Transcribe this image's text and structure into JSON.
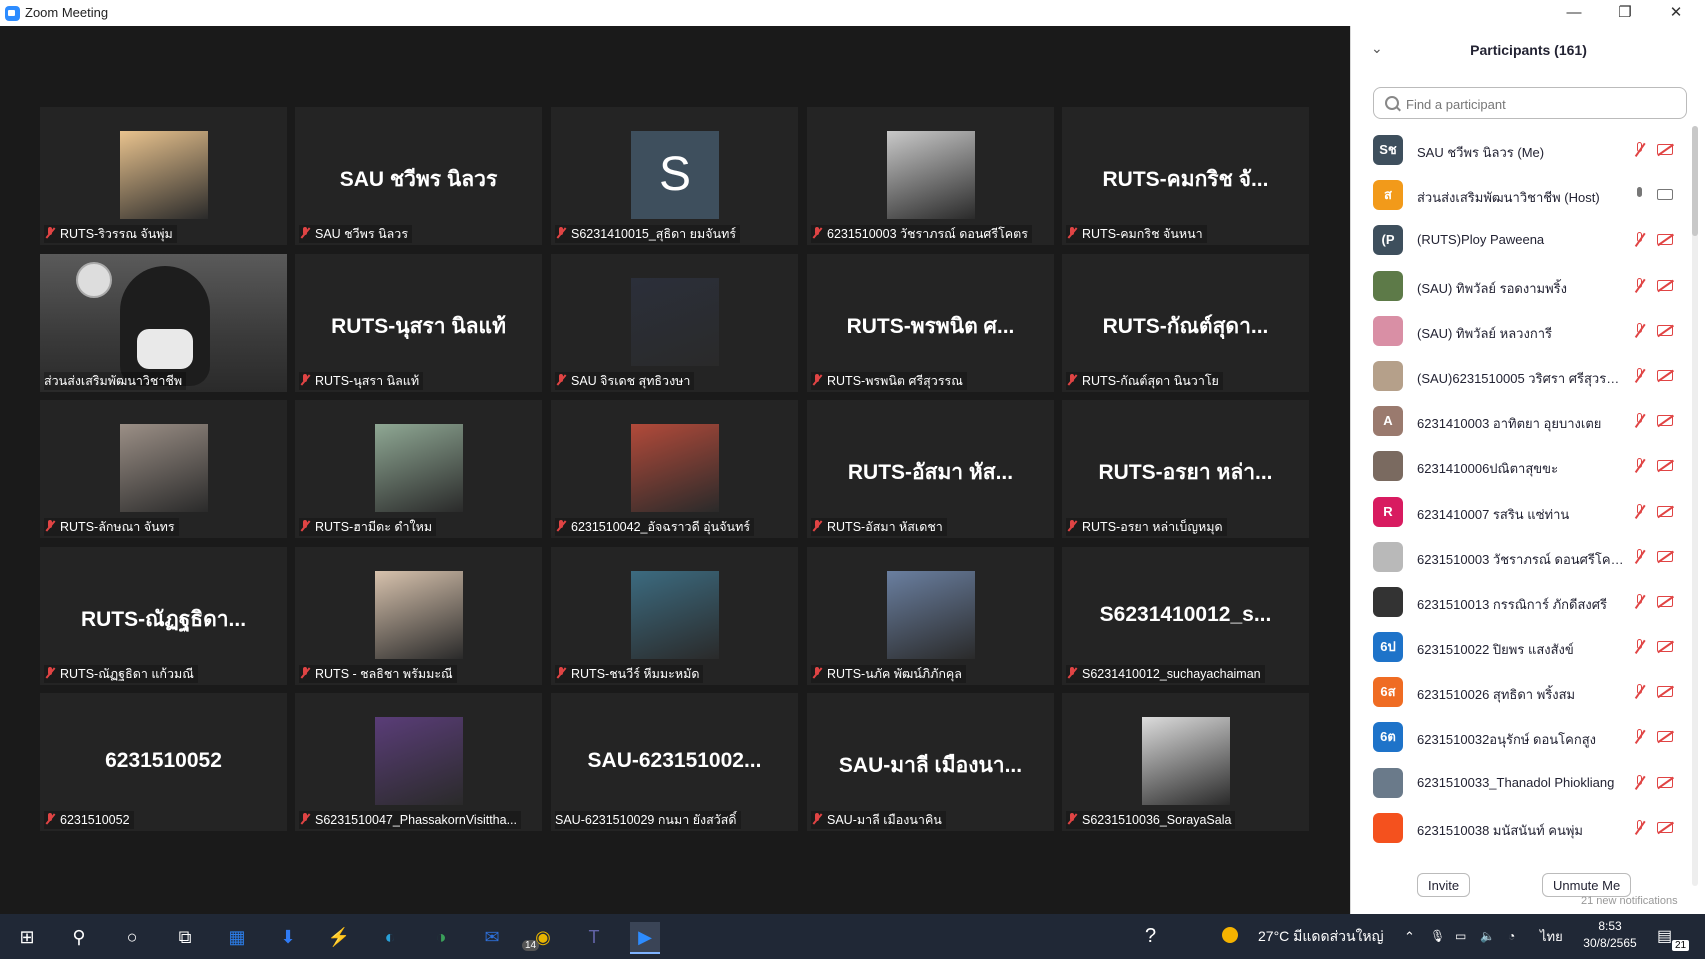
{
  "window": {
    "title": "Zoom Meeting",
    "minimize": "—",
    "restore": "❐",
    "close": "✕"
  },
  "tiles": [
    {
      "label": "RUTS-ริวรรณ จันพุ่ม",
      "big": "",
      "thumb": "photo",
      "color": "#e9c38e"
    },
    {
      "label": "SAU ชวีพร นิลวร",
      "big": "SAU ชวีพร นิลวร"
    },
    {
      "label": "S6231410015_สุธิดา ยมจันทร์",
      "big": "",
      "thumb": "letter",
      "letter": "S"
    },
    {
      "label": "6231510003 วัชราภรณ์ ดอนศรีโคตร",
      "big": "",
      "thumb": "photo",
      "color": "#c9c9c9"
    },
    {
      "label": "RUTS-คมกริช จันหนา",
      "big": "RUTS-คมกริช  จั..."
    },
    {
      "label": "ส่วนส่งเสริมพัฒนาวิชาชีพ",
      "big": "",
      "thumb": "full"
    },
    {
      "label": "RUTS-นุสรา นิลแท้",
      "big": "RUTS-นุสรา นิลแท้"
    },
    {
      "label": "SAU จิรเดช สุทธิวงษา",
      "big": "",
      "thumb": "photo",
      "color": "#2b2f3a"
    },
    {
      "label": "RUTS-พรพนิต ศรีสุวรรณ",
      "big": "RUTS-พรพนิต ศ..."
    },
    {
      "label": "RUTS-กัณต์สุดา นินวาโย",
      "big": "RUTS-กัณต์สุดา..."
    },
    {
      "label": "RUTS-ลักษณา จันทร",
      "big": "",
      "thumb": "photo",
      "color": "#9b8f86"
    },
    {
      "label": "RUTS-ฮามีดะ ดำใหม",
      "big": "",
      "thumb": "photo",
      "color": "#8fa894"
    },
    {
      "label": "6231510042_อัจฉราวดี อุ่นจันทร์",
      "big": "",
      "thumb": "photo",
      "color": "#b24a3a"
    },
    {
      "label": "RUTS-อัสมา หัสเดชา",
      "big": "RUTS-อัสมา หัส..."
    },
    {
      "label": "RUTS-อรยา หล่าเบ็ญหมุด",
      "big": "RUTS-อรยา  หล่า..."
    },
    {
      "label": "RUTS-ณัฏฐธิดา แก้วมณี",
      "big": "RUTS-ณัฏฐธิดา..."
    },
    {
      "label": "RUTS - ชลธิชา พรัมมะณี",
      "big": "",
      "thumb": "photo",
      "color": "#d7c2ad"
    },
    {
      "label": "RUTS-ชนวีร์ หีมมะหมัด",
      "big": "",
      "thumb": "photo",
      "color": "#3c6b80"
    },
    {
      "label": "RUTS-นภัค พัฒน์ภิภักคุล",
      "big": "",
      "thumb": "photo",
      "color": "#6a7fa0"
    },
    {
      "label": "S6231410012_suchayachaiman",
      "big": "S6231410012_s..."
    },
    {
      "label": "6231510052",
      "big": "6231510052"
    },
    {
      "label": "S6231510047_PhassakornVisittha...",
      "big": "",
      "thumb": "photo",
      "color": "#5a3d78"
    },
    {
      "label": "SAU-6231510029 กนมา ยังสวัสดิ์",
      "big": "SAU-623151002...",
      "nomic": true
    },
    {
      "label": "SAU-มาลี เมืองนาคิน",
      "big": "SAU-มาลี เมืองนา..."
    },
    {
      "label": "S6231510036_SorayaSala",
      "big": "",
      "thumb": "photo",
      "color": "#dcdcdc"
    }
  ],
  "panel": {
    "title": "Participants (161)",
    "search_placeholder": "Find a participant",
    "invite": "Invite",
    "unmute": "Unmute Me",
    "notifications": "21 new notifications",
    "participants": [
      {
        "name": "SAU ชวีพร นิลวร (Me)",
        "avatar": "Sช",
        "color": "#3e4f5d",
        "mic": "off",
        "cam": "off"
      },
      {
        "name": "ส่วนส่งเสริมพัฒนาวิชาชีพ (Host)",
        "avatar": "ส",
        "color": "#f29a1a",
        "mic": "on",
        "cam": "on"
      },
      {
        "name": "(RUTS)Ploy Paweena",
        "avatar": "(P",
        "color": "#3e4f5d",
        "mic": "off",
        "cam": "off"
      },
      {
        "name": "(SAU) ทิพวัลย์ รอดงามพริ้ง",
        "avatar": "",
        "color": "#5d7a48",
        "mic": "off",
        "cam": "off"
      },
      {
        "name": "(SAU) ทิพวัลย์ หลวงการี",
        "avatar": "",
        "color": "#d98fa5",
        "mic": "off",
        "cam": "off"
      },
      {
        "name": "(SAU)6231510005 วริศรา ศรีสุวรรณ",
        "avatar": "",
        "color": "#b5a08a",
        "mic": "off",
        "cam": "off"
      },
      {
        "name": "6231410003 อาทิตยา อุยบางเตย",
        "avatar": "A",
        "color": "#9a7a6e",
        "mic": "off",
        "cam": "off"
      },
      {
        "name": "6231410006ปณิตาสุขขะ",
        "avatar": "",
        "color": "#7a6a60",
        "mic": "off",
        "cam": "off"
      },
      {
        "name": "6231410007 รสริน แซ่ท่าน",
        "avatar": "R",
        "color": "#d81b60",
        "mic": "off",
        "cam": "off"
      },
      {
        "name": "6231510003 วัชราภรณ์ ดอนศรีโคตร",
        "avatar": "",
        "color": "#b9b9b9",
        "mic": "off",
        "cam": "off"
      },
      {
        "name": "6231510013 กรรณิการ์ ภักดีสงศรี",
        "avatar": "",
        "color": "#333333",
        "mic": "off",
        "cam": "off"
      },
      {
        "name": "6231510022 ปิยพร แสงสังข์",
        "avatar": "6ป",
        "color": "#1e73c9",
        "mic": "off",
        "cam": "off"
      },
      {
        "name": "6231510026 สุทธิดา พริ้งสม",
        "avatar": "6ส",
        "color": "#ef6c23",
        "mic": "off",
        "cam": "off"
      },
      {
        "name": "6231510032อนุรักษ์ ดอนโคกสูง",
        "avatar": "6ต",
        "color": "#1e73c9",
        "mic": "off",
        "cam": "off"
      },
      {
        "name": "6231510033_Thanadol Phiokliang",
        "avatar": "",
        "color": "#6a7a8a",
        "mic": "off",
        "cam": "off"
      },
      {
        "name": "6231510038 มนัสนันท์ คนพุ่ม",
        "avatar": "",
        "color": "#f4511e",
        "mic": "off",
        "cam": "off"
      }
    ]
  },
  "taskbar": {
    "weather": "27°C มีแดดส่วนใหญ่",
    "lang": "ไทย",
    "time": "8:53",
    "date": "30/8/2565",
    "mail_badge": "14",
    "notif_badge": "21",
    "start_icon": "⊞",
    "search_icon": "⚲",
    "cortana_icon": "○",
    "taskview_icon": "⧉",
    "icons": [
      "▦",
      "⬇",
      "⚡",
      "◐",
      "◑",
      "✉",
      "◉",
      "T",
      "▶"
    ]
  }
}
